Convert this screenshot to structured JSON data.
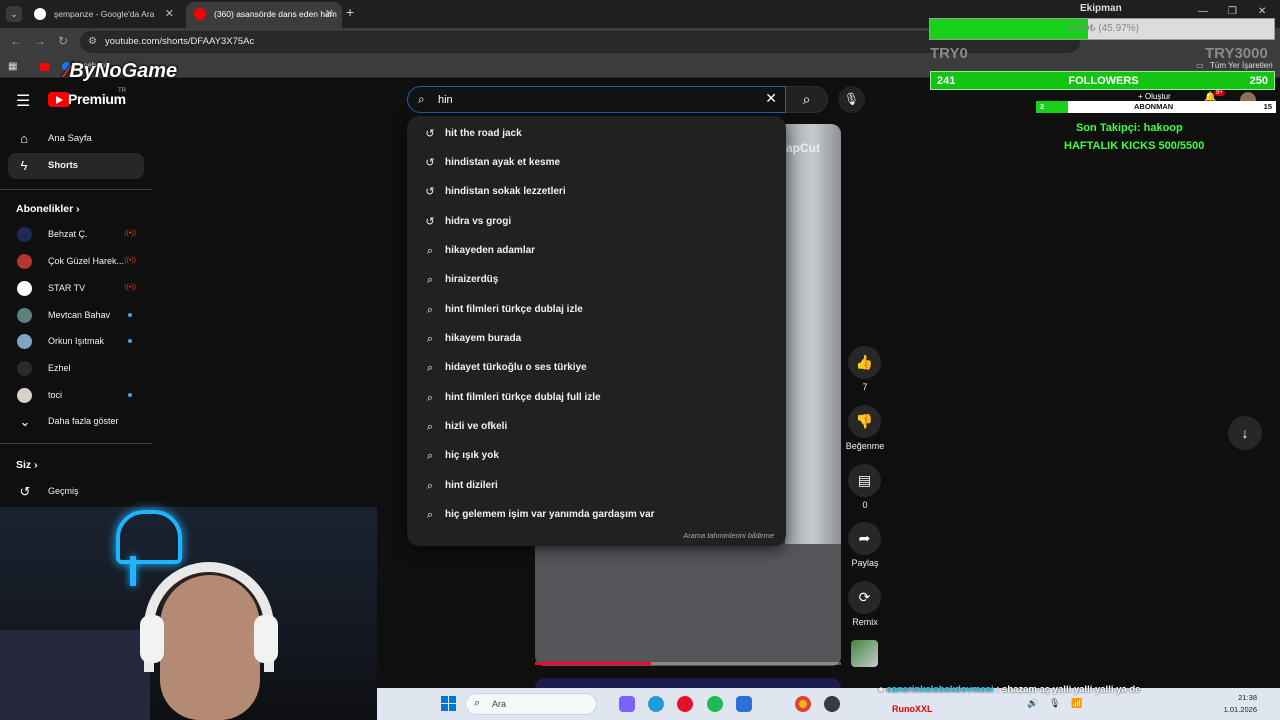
{
  "browser": {
    "tabs": [
      {
        "title": "şempanze - Google'da Ara",
        "favicon_color": "#ffffff"
      },
      {
        "title": "(360) asansörde dans eden ham",
        "favicon_color": "#ff0000"
      }
    ],
    "url": "youtube.com/shorts/DFAAY3X75Ac",
    "bookmarks": [
      {
        "label": "Facebook"
      },
      {
        "label": "Tüm Yer İşaretleri"
      }
    ]
  },
  "youtube": {
    "logo_text": "Premium",
    "region": "TR",
    "search": {
      "query": "hin",
      "suggestions": [
        {
          "text": "hit the road jack",
          "icon": "history-icon"
        },
        {
          "text": "hindistan ayak et kesme",
          "icon": "history-icon"
        },
        {
          "text": "hindistan sokak lezzetleri",
          "icon": "history-icon"
        },
        {
          "text": "hidra vs grogi",
          "icon": "history-icon"
        },
        {
          "text": "hikayeden adamlar",
          "icon": "search-icon"
        },
        {
          "text": "hiraizerdüş",
          "icon": "search-icon"
        },
        {
          "text": "hint filmleri türkçe dublaj izle",
          "icon": "search-icon"
        },
        {
          "text": "hikayem burada",
          "icon": "search-icon"
        },
        {
          "text": "hidayet türkoğlu o ses türkiye",
          "icon": "search-icon"
        },
        {
          "text": "hint filmleri türkçe dublaj full izle",
          "icon": "search-icon"
        },
        {
          "text": "hizli ve ofkeli",
          "icon": "search-icon"
        },
        {
          "text": "hiç ışık yok",
          "icon": "search-icon"
        },
        {
          "text": "hint dizileri",
          "icon": "search-icon"
        },
        {
          "text": "hiç gelemem işim var yanımda gardaşım var",
          "icon": "search-icon"
        }
      ],
      "report_label": "Arama tahminlerini bildirme"
    },
    "sidebar": {
      "items": [
        {
          "label": "Ana Sayfa",
          "icon": "home-icon"
        },
        {
          "label": "Shorts",
          "icon": "shorts-icon"
        }
      ],
      "subscriptions_title": "Abonelikler",
      "subscriptions": [
        {
          "label": "Behzat Ç.",
          "status": "live",
          "avatar_color": "#1c2a57"
        },
        {
          "label": "Çok Güzel Harek...",
          "status": "live",
          "avatar_color": "#b3362e"
        },
        {
          "label": "STAR TV",
          "status": "live",
          "avatar_color": "#ffffff"
        },
        {
          "label": "Mevtcan Bahav",
          "status": "new",
          "avatar_color": "#5e7f7a"
        },
        {
          "label": "Orkun Işıtmak",
          "status": "new",
          "avatar_color": "#7fa4c4"
        },
        {
          "label": "Ezhel",
          "status": "none",
          "avatar_color": "#2b2b2b"
        },
        {
          "label": "toci",
          "status": "new",
          "avatar_color": "#d7d2c7"
        }
      ],
      "show_more": "Daha fazla göster",
      "you_title": "Siz",
      "history": "Geçmiş"
    },
    "short": {
      "watermark": "apCut",
      "progress_fraction": 0.38,
      "actions": [
        {
          "name": "like",
          "icon": "thumbs-up-icon",
          "label": "7"
        },
        {
          "name": "dislike",
          "icon": "thumbs-down-icon",
          "label": "Beğenme"
        },
        {
          "name": "comments",
          "icon": "comment-icon",
          "label": "0"
        },
        {
          "name": "share",
          "icon": "share-icon",
          "label": "Paylaş"
        },
        {
          "name": "remix",
          "icon": "remix-icon",
          "label": "Remix"
        }
      ]
    },
    "header_right": {
      "create_label": "Oluştur",
      "notif_badge": "9+"
    }
  },
  "stream_overlay": {
    "brand": "ByNoGame",
    "equipment_title": "Ekipman",
    "goal_text": "1379₺ (45.97%)",
    "goal_fraction": 0.4597,
    "goal_start": "TRY0",
    "goal_end": "TRY3000",
    "followers": {
      "current": "241",
      "label": "FOLLOWERS",
      "target": "250",
      "fraction": 0.964
    },
    "subscribers": {
      "current": "2",
      "label": "ABONMAN",
      "target": "15",
      "fraction": 0.133
    },
    "last_follower": "Son Takipçi: hakoop",
    "weekly_kicks": "HAFTALIK KICKS 500/5500",
    "chat": {
      "user": "canerinkelebekdovmesi",
      "message": ": shazam aç yalli yalli yalli ya de"
    },
    "streamer_tag": "RunoXXL"
  },
  "taskbar": {
    "search_label": "Ara",
    "time": "21:38",
    "date": "1.01.2026",
    "apps": [
      {
        "name": "copilot",
        "color": "#7b61ff"
      },
      {
        "name": "edge",
        "color": "#1e9ad6"
      },
      {
        "name": "opera",
        "color": "#e3102b"
      },
      {
        "name": "spotify",
        "color": "#1db954"
      },
      {
        "name": "store",
        "color": "#2d6fd6"
      },
      {
        "name": "chrome",
        "color": "#f2b50f"
      },
      {
        "name": "obs",
        "color": "#3a3a3a"
      }
    ]
  },
  "colors": {
    "youtube_red": "#ff0000",
    "accent_blue": "#1c62b9",
    "overlay_green": "#19d11a",
    "text_green": "#3dff3d"
  }
}
